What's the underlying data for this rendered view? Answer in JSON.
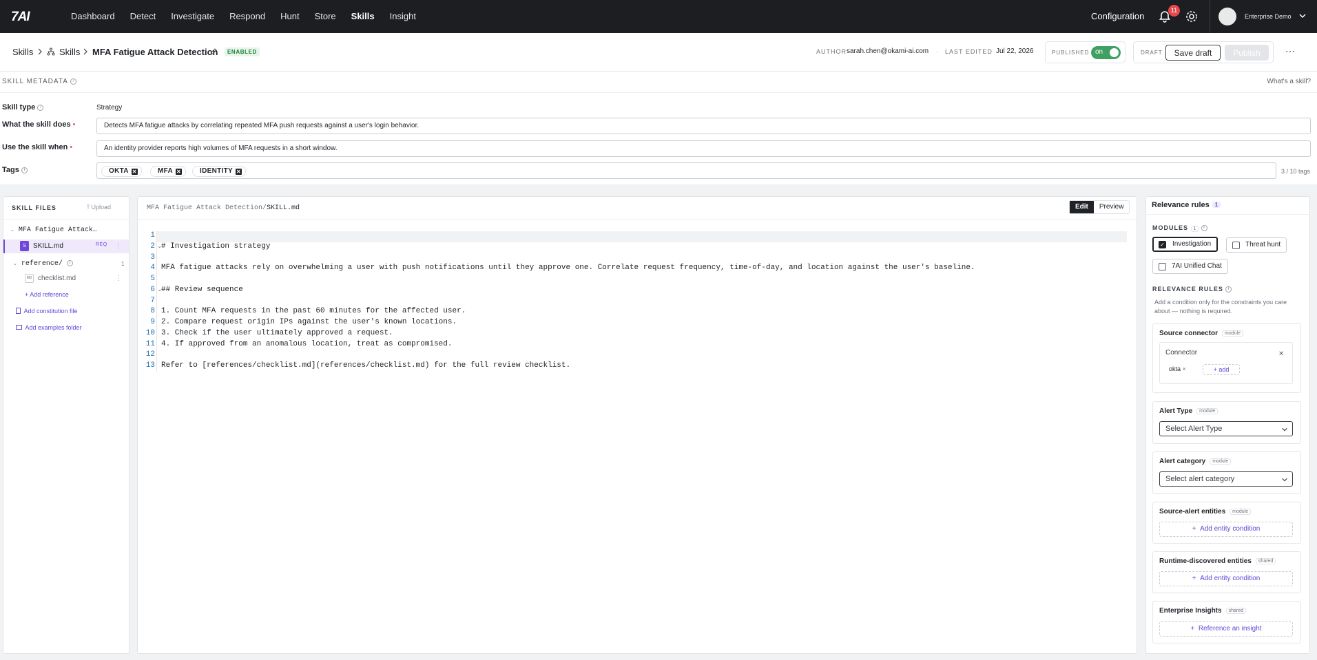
{
  "app": {
    "logo": "7AI"
  },
  "nav": {
    "items": [
      "Dashboard",
      "Detect",
      "Investigate",
      "Respond",
      "Hunt",
      "Store",
      "Skills",
      "Insight"
    ],
    "active": "Skills",
    "configuration": "Configuration",
    "notifications": "11",
    "user": "Enterprise Demo"
  },
  "breadcrumb": {
    "root": "Skills",
    "parent": "Skills",
    "current": "MFA Fatigue Attack Detection",
    "status": "ENABLED"
  },
  "header": {
    "author_label": "AUTHOR",
    "author": "sarah.chen@okami-ai.com",
    "edited_label": "LAST EDITED",
    "edited": "Jul 22, 2026",
    "published_label": "PUBLISHED",
    "toggle": "on",
    "draft_label": "DRAFT",
    "save_draft": "Save draft",
    "publish": "Publish"
  },
  "metadata": {
    "title": "SKILL METADATA",
    "whats": "What's a skill?",
    "skill_type_label": "Skill type",
    "skill_type": "Strategy",
    "does_label": "What the skill does",
    "does": "Detects MFA fatigue attacks by correlating repeated MFA push requests against a user's login behavior.",
    "when_label": "Use the skill when",
    "when": "An identity provider reports high volumes of MFA requests in a short window.",
    "tags_label": "Tags",
    "tags": [
      "OKTA",
      "MFA",
      "IDENTITY"
    ],
    "tag_count": "3 / 10 tags"
  },
  "files": {
    "title": "SKILL FILES",
    "upload": "Upload",
    "root": "MFA Fatigue Attack…",
    "skill_file": "SKILL.md",
    "skill_icon": "S",
    "req": "REQ",
    "folder": "reference/",
    "folder_count": "1",
    "ref_icon": "MD",
    "ref_file": "checklist.md",
    "add_reference": "Add reference",
    "add_constitution": "Add constitution file",
    "add_examples": "Add examples folder"
  },
  "editor": {
    "path_prefix": "MFA Fatigue Attack Detection/",
    "path_file": "SKILL.md",
    "tab_edit": "Edit",
    "tab_preview": "Preview",
    "lines": [
      "",
      "# Investigation strategy",
      "",
      "MFA fatigue attacks rely on overwhelming a user with push notifications until they approve one. Correlate request frequency, time-of-day, and location against the user's baseline.",
      "",
      "## Review sequence",
      "",
      "1. Count MFA requests in the past 60 minutes for the affected user.",
      "2. Compare request origin IPs against the user's known locations.",
      "3. Check if the user ultimately approved a request.",
      "4. If approved from an anomalous location, treat as compromised.",
      "",
      "Refer to [references/checklist.md](references/checklist.md) for the full review checklist."
    ],
    "line_numbers": [
      "1",
      "2",
      "3",
      "4",
      "5",
      "6",
      "7",
      "8",
      "9",
      "10",
      "11",
      "12",
      "13"
    ]
  },
  "rules": {
    "title": "Relevance rules",
    "title_count": "1",
    "modules_label": "MODULES",
    "modules_count": "1",
    "modules": [
      {
        "label": "Investigation",
        "checked": true
      },
      {
        "label": "Threat hunt",
        "checked": false
      },
      {
        "label": "7AI Unified Chat",
        "checked": false
      }
    ],
    "rules_label": "RELEVANCE RULES",
    "help": "Add a condition only for the constraints you care about — nothing is required.",
    "source_connector": "Source connector",
    "module_pill": "module",
    "shared_pill": "shared",
    "connector_label": "Connector",
    "connector_value": "okta",
    "add": "+ add",
    "alert_type": "Alert Type",
    "alert_type_placeholder": "Select Alert Type",
    "alert_category": "Alert category",
    "alert_category_placeholder": "Select alert category",
    "source_entities": "Source-alert entities",
    "add_entity": "Add entity condition",
    "runtime_entities": "Runtime-discovered entities",
    "enterprise_insights": "Enterprise Insights",
    "reference_insight": "Reference an insight"
  }
}
